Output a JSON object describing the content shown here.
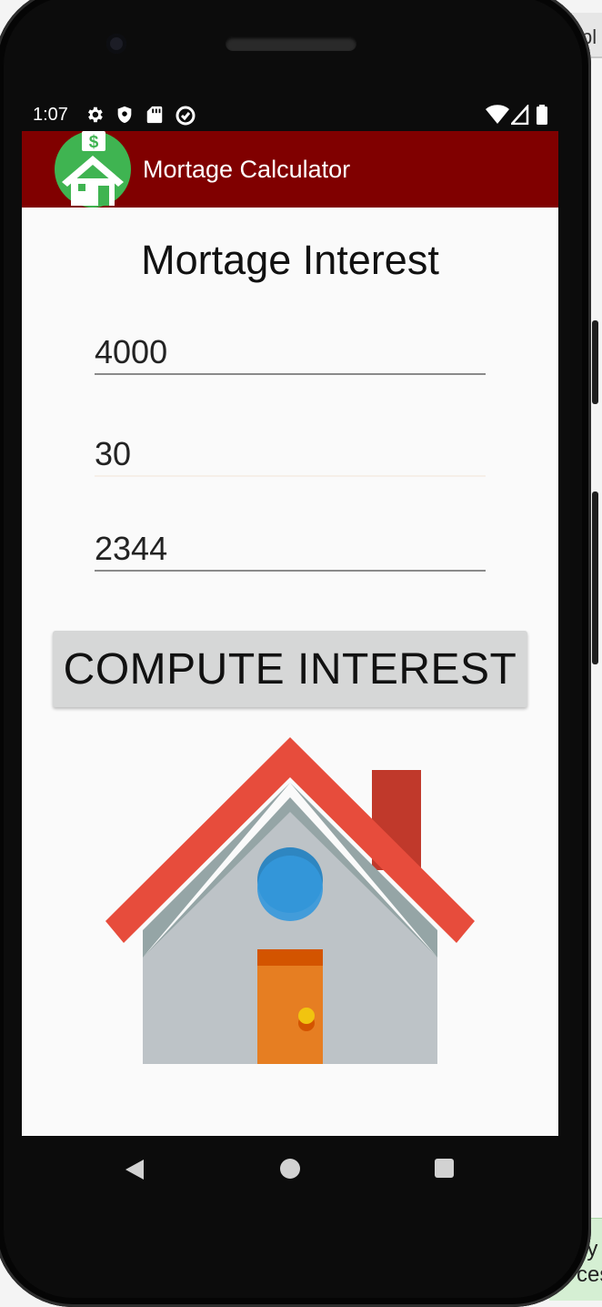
{
  "background": {
    "tab_fragment": "pl",
    "panel_fragment_1": "ly",
    "panel_fragment_2": "cess"
  },
  "status_bar": {
    "time": "1:07",
    "left_icons": [
      "settings-icon",
      "shield-icon",
      "sd-card-icon",
      "data-saver-icon"
    ],
    "right_icons": [
      "wifi-icon",
      "cell-signal-icon",
      "battery-icon"
    ]
  },
  "app_bar": {
    "title": "Mortage Calculator",
    "color": "#800000",
    "logo_icon": "house-dollar-logo"
  },
  "main": {
    "heading": "Mortage Interest",
    "fields": [
      {
        "value": "4000"
      },
      {
        "value": "30"
      },
      {
        "value": "2344"
      }
    ],
    "compute_button_label": "COMPUTE INTEREST",
    "illustration": "house-illustration"
  },
  "nav_bar": {
    "buttons": [
      "back-icon",
      "home-icon",
      "recents-icon"
    ]
  },
  "colors": {
    "screen_bg": "#fafafa",
    "button_bg": "#d6d7d7",
    "roof": "#e74c3c",
    "wall": "#bdc3c7",
    "door": "#e67e22",
    "window": "#3498db"
  }
}
